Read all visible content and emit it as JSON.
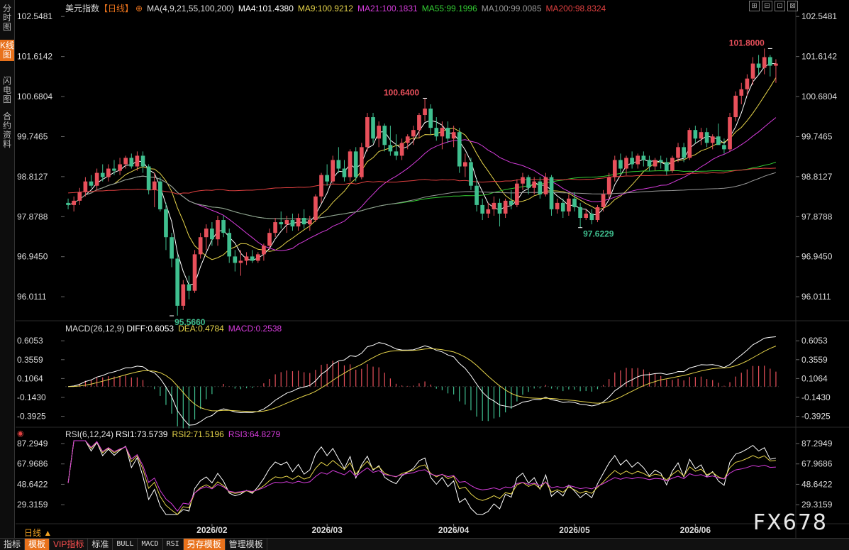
{
  "sidebar": [
    {
      "label": "分时图",
      "active": false
    },
    {
      "label": "K线图",
      "active": true
    },
    {
      "label": "闪电图",
      "active": false
    },
    {
      "label": "合约资料",
      "active": false
    }
  ],
  "header": {
    "symbol": "美元指数",
    "period": "【日线】",
    "settings_icon": "gear-icon",
    "ma_params": "MA(4,9,21,55,100,200)",
    "ma": [
      {
        "label": "MA4:101.4380",
        "color": "#ffffff"
      },
      {
        "label": "MA9:100.9212",
        "color": "#e6d44a"
      },
      {
        "label": "MA21:100.1831",
        "color": "#d63cdc"
      },
      {
        "label": "MA55:99.1996",
        "color": "#33cc33"
      },
      {
        "label": "MA100:99.0085",
        "color": "#999999"
      },
      {
        "label": "MA200:98.8324",
        "color": "#e04040"
      }
    ]
  },
  "tools": [
    "⊞",
    "⊟",
    "⊡",
    "⊠"
  ],
  "macd": {
    "title": "MACD(26,12,9)",
    "diff": "DIFF:0.6053",
    "dea": "DEA:0.4784",
    "macd": "MACD:0.2538"
  },
  "rsi": {
    "title": "RSI(6,12,24)",
    "rsi1": "RSI1:73.5739",
    "rsi2": "RSI2:71.5196",
    "rsi3": "RSI3:64.8279"
  },
  "toolbar": [
    {
      "label": "指标",
      "style": ""
    },
    {
      "label": "模板",
      "style": "orange"
    },
    {
      "label": "VIP指标",
      "style": "red"
    },
    {
      "label": "标准",
      "style": ""
    },
    {
      "label": "BULL",
      "style": "mono"
    },
    {
      "label": "MACD",
      "style": "mono"
    },
    {
      "label": "RSI",
      "style": "mono"
    },
    {
      "label": "另存模板",
      "style": "orange"
    },
    {
      "label": "管理模板",
      "style": ""
    }
  ],
  "period_selector": "日线 ▲",
  "watermark": "FX678",
  "chart_data": {
    "type": "candlestick",
    "price_axis": {
      "ticks": [
        "102.5481",
        "101.6142",
        "100.6804",
        "99.7465",
        "98.8127",
        "97.8788",
        "96.9450",
        "96.0111"
      ],
      "range": [
        95.45,
        102.8
      ]
    },
    "macd_axis": {
      "ticks": [
        "0.6053",
        "0.3559",
        "0.1064",
        "-0.1430",
        "-0.3925"
      ],
      "range": [
        -0.5,
        0.72
      ]
    },
    "rsi_axis": {
      "ticks": [
        "87.2949",
        "67.9686",
        "48.6422",
        "29.3159"
      ],
      "range": [
        18,
        92
      ]
    },
    "x_labels": [
      {
        "label": "2026/02",
        "index": 25
      },
      {
        "label": "2026/03",
        "index": 45
      },
      {
        "label": "2026/04",
        "index": 67
      },
      {
        "label": "2026/05",
        "index": 88
      },
      {
        "label": "2026/06",
        "index": 109
      }
    ],
    "annotations": [
      {
        "label": "95.5660",
        "index": 18,
        "value": 95.566,
        "dir": "low"
      },
      {
        "label": "100.6400",
        "index": 62,
        "value": 100.64,
        "dir": "high"
      },
      {
        "label": "97.6229",
        "index": 89,
        "value": 97.6229,
        "dir": "low"
      },
      {
        "label": "101.8000",
        "index": 122,
        "value": 101.8,
        "dir": "high"
      }
    ],
    "candles": [
      [
        98.2,
        98.3,
        98.05,
        98.15
      ],
      [
        98.15,
        98.35,
        98.0,
        98.25
      ],
      [
        98.25,
        98.55,
        98.15,
        98.45
      ],
      [
        98.45,
        98.8,
        98.35,
        98.7
      ],
      [
        98.7,
        98.85,
        98.55,
        98.6
      ],
      [
        98.6,
        99.0,
        98.5,
        98.9
      ],
      [
        98.9,
        99.1,
        98.7,
        98.8
      ],
      [
        98.8,
        99.1,
        98.7,
        99.0
      ],
      [
        99.0,
        99.2,
        98.85,
        98.95
      ],
      [
        98.95,
        99.25,
        98.85,
        99.1
      ],
      [
        99.1,
        99.3,
        99.0,
        99.25
      ],
      [
        99.25,
        99.35,
        99.0,
        99.05
      ],
      [
        99.05,
        99.4,
        98.95,
        99.3
      ],
      [
        99.3,
        99.4,
        98.9,
        99.05
      ],
      [
        99.05,
        99.1,
        98.4,
        98.5
      ],
      [
        98.5,
        98.9,
        98.1,
        98.7
      ],
      [
        98.7,
        98.8,
        98.0,
        98.05
      ],
      [
        98.05,
        98.2,
        97.1,
        97.4
      ],
      [
        97.4,
        97.5,
        96.7,
        96.9
      ],
      [
        96.9,
        97.0,
        95.57,
        95.8
      ],
      [
        95.8,
        96.4,
        95.7,
        96.3
      ],
      [
        96.3,
        96.5,
        95.95,
        96.15
      ],
      [
        96.15,
        97.1,
        96.1,
        97.0
      ],
      [
        97.0,
        97.5,
        96.9,
        97.4
      ],
      [
        97.4,
        97.7,
        97.1,
        97.6
      ],
      [
        97.6,
        97.75,
        97.2,
        97.35
      ],
      [
        97.35,
        97.9,
        97.2,
        97.8
      ],
      [
        97.8,
        97.9,
        97.4,
        97.5
      ],
      [
        97.5,
        97.6,
        96.8,
        96.95
      ],
      [
        96.95,
        97.1,
        96.6,
        96.8
      ],
      [
        96.8,
        97.1,
        96.5,
        96.85
      ],
      [
        96.85,
        97.05,
        96.75,
        96.95
      ],
      [
        96.95,
        97.1,
        96.8,
        96.85
      ],
      [
        96.85,
        97.05,
        96.8,
        97.0
      ],
      [
        97.0,
        97.25,
        96.85,
        97.2
      ],
      [
        97.2,
        97.6,
        97.1,
        97.5
      ],
      [
        97.5,
        97.85,
        97.4,
        97.75
      ],
      [
        97.75,
        98.0,
        97.6,
        97.7
      ],
      [
        97.7,
        97.9,
        97.5,
        97.8
      ],
      [
        97.8,
        97.95,
        97.55,
        97.65
      ],
      [
        97.65,
        97.95,
        97.55,
        97.85
      ],
      [
        97.85,
        98.05,
        97.6,
        97.7
      ],
      [
        97.7,
        97.9,
        97.55,
        97.8
      ],
      [
        97.8,
        98.4,
        97.75,
        98.35
      ],
      [
        98.35,
        98.9,
        98.2,
        98.85
      ],
      [
        98.85,
        99.1,
        98.6,
        98.7
      ],
      [
        98.7,
        99.3,
        98.65,
        99.2
      ],
      [
        99.2,
        99.5,
        98.9,
        99.0
      ],
      [
        99.0,
        99.2,
        98.7,
        98.8
      ],
      [
        98.8,
        99.45,
        98.7,
        99.4
      ],
      [
        99.4,
        99.5,
        98.7,
        98.8
      ],
      [
        98.8,
        99.6,
        98.75,
        99.5
      ],
      [
        99.5,
        100.3,
        99.4,
        100.2
      ],
      [
        100.2,
        100.3,
        99.6,
        99.7
      ],
      [
        99.7,
        100.1,
        99.5,
        100.0
      ],
      [
        100.0,
        100.05,
        99.4,
        99.55
      ],
      [
        99.55,
        100.0,
        99.3,
        99.4
      ],
      [
        99.4,
        99.8,
        99.2,
        99.3
      ],
      [
        99.3,
        99.7,
        99.2,
        99.6
      ],
      [
        99.6,
        99.8,
        99.45,
        99.75
      ],
      [
        99.75,
        100.0,
        99.55,
        99.9
      ],
      [
        99.9,
        100.3,
        99.7,
        100.25
      ],
      [
        100.25,
        100.64,
        100.1,
        100.4
      ],
      [
        100.4,
        100.5,
        99.8,
        99.95
      ],
      [
        99.95,
        100.2,
        99.65,
        99.75
      ],
      [
        99.75,
        100.1,
        99.45,
        99.95
      ],
      [
        99.95,
        100.1,
        99.6,
        99.7
      ],
      [
        99.7,
        100.0,
        99.5,
        99.85
      ],
      [
        99.85,
        99.95,
        98.9,
        99.05
      ],
      [
        99.05,
        99.35,
        98.8,
        99.15
      ],
      [
        99.15,
        99.25,
        98.5,
        98.6
      ],
      [
        98.6,
        98.75,
        98.0,
        98.15
      ],
      [
        98.15,
        98.3,
        97.8,
        97.95
      ],
      [
        97.95,
        98.2,
        97.85,
        98.05
      ],
      [
        98.05,
        98.35,
        97.9,
        98.2
      ],
      [
        98.2,
        98.3,
        97.65,
        97.95
      ],
      [
        97.95,
        98.3,
        97.85,
        98.25
      ],
      [
        98.25,
        98.5,
        98.05,
        98.15
      ],
      [
        98.15,
        98.75,
        98.1,
        98.65
      ],
      [
        98.65,
        98.9,
        98.5,
        98.8
      ],
      [
        98.8,
        98.85,
        98.4,
        98.55
      ],
      [
        98.55,
        98.8,
        98.4,
        98.7
      ],
      [
        98.7,
        98.8,
        98.3,
        98.4
      ],
      [
        98.4,
        98.9,
        98.35,
        98.8
      ],
      [
        98.8,
        98.85,
        97.9,
        98.05
      ],
      [
        98.05,
        98.3,
        97.95,
        98.2
      ],
      [
        98.2,
        98.3,
        97.85,
        98.0
      ],
      [
        98.0,
        98.4,
        97.9,
        98.3
      ],
      [
        98.3,
        98.45,
        98.0,
        98.1
      ],
      [
        98.1,
        98.2,
        97.62,
        97.85
      ],
      [
        97.85,
        98.05,
        97.8,
        97.95
      ],
      [
        97.95,
        98.05,
        97.7,
        97.8
      ],
      [
        97.8,
        98.15,
        97.75,
        98.1
      ],
      [
        98.1,
        98.5,
        98.0,
        98.4
      ],
      [
        98.4,
        98.9,
        98.3,
        98.8
      ],
      [
        98.8,
        99.3,
        98.7,
        99.2
      ],
      [
        99.2,
        99.35,
        98.9,
        99.0
      ],
      [
        99.0,
        99.3,
        98.85,
        99.25
      ],
      [
        99.25,
        99.4,
        99.0,
        99.1
      ],
      [
        99.1,
        99.35,
        99.0,
        99.3
      ],
      [
        99.3,
        99.4,
        99.05,
        99.2
      ],
      [
        99.2,
        99.3,
        98.95,
        99.05
      ],
      [
        99.05,
        99.25,
        98.95,
        99.2
      ],
      [
        99.2,
        99.3,
        99.0,
        99.15
      ],
      [
        99.15,
        99.25,
        98.85,
        98.95
      ],
      [
        98.95,
        99.3,
        98.9,
        99.25
      ],
      [
        99.25,
        99.6,
        99.15,
        99.5
      ],
      [
        99.5,
        99.6,
        99.15,
        99.25
      ],
      [
        99.25,
        99.95,
        99.2,
        99.9
      ],
      [
        99.9,
        100.0,
        99.6,
        99.7
      ],
      [
        99.7,
        99.95,
        99.55,
        99.85
      ],
      [
        99.85,
        99.95,
        99.5,
        99.6
      ],
      [
        99.6,
        99.8,
        99.45,
        99.75
      ],
      [
        99.75,
        100.05,
        99.6,
        99.55
      ],
      [
        99.55,
        99.7,
        99.35,
        99.45
      ],
      [
        99.45,
        100.3,
        99.4,
        100.2
      ],
      [
        100.2,
        100.8,
        100.1,
        100.7
      ],
      [
        100.7,
        101.0,
        100.5,
        100.85
      ],
      [
        100.85,
        101.2,
        100.7,
        101.1
      ],
      [
        101.1,
        101.6,
        100.95,
        101.45
      ],
      [
        101.45,
        101.65,
        101.2,
        101.35
      ],
      [
        101.35,
        101.8,
        101.2,
        101.6
      ],
      [
        101.6,
        101.65,
        101.15,
        101.4
      ],
      [
        101.4,
        101.55,
        101.0,
        101.45
      ]
    ],
    "ma_series": [
      {
        "name": "MA4",
        "color": "#ffffff",
        "window": 4
      },
      {
        "name": "MA9",
        "color": "#e6d44a",
        "window": 9
      },
      {
        "name": "MA21",
        "color": "#d63cdc",
        "window": 21
      },
      {
        "name": "MA55",
        "color": "#33cc33",
        "window": 55
      },
      {
        "name": "MA100",
        "color": "#999999",
        "window": 100
      },
      {
        "name": "MA200",
        "color": "#e04040",
        "window": 200
      }
    ]
  }
}
